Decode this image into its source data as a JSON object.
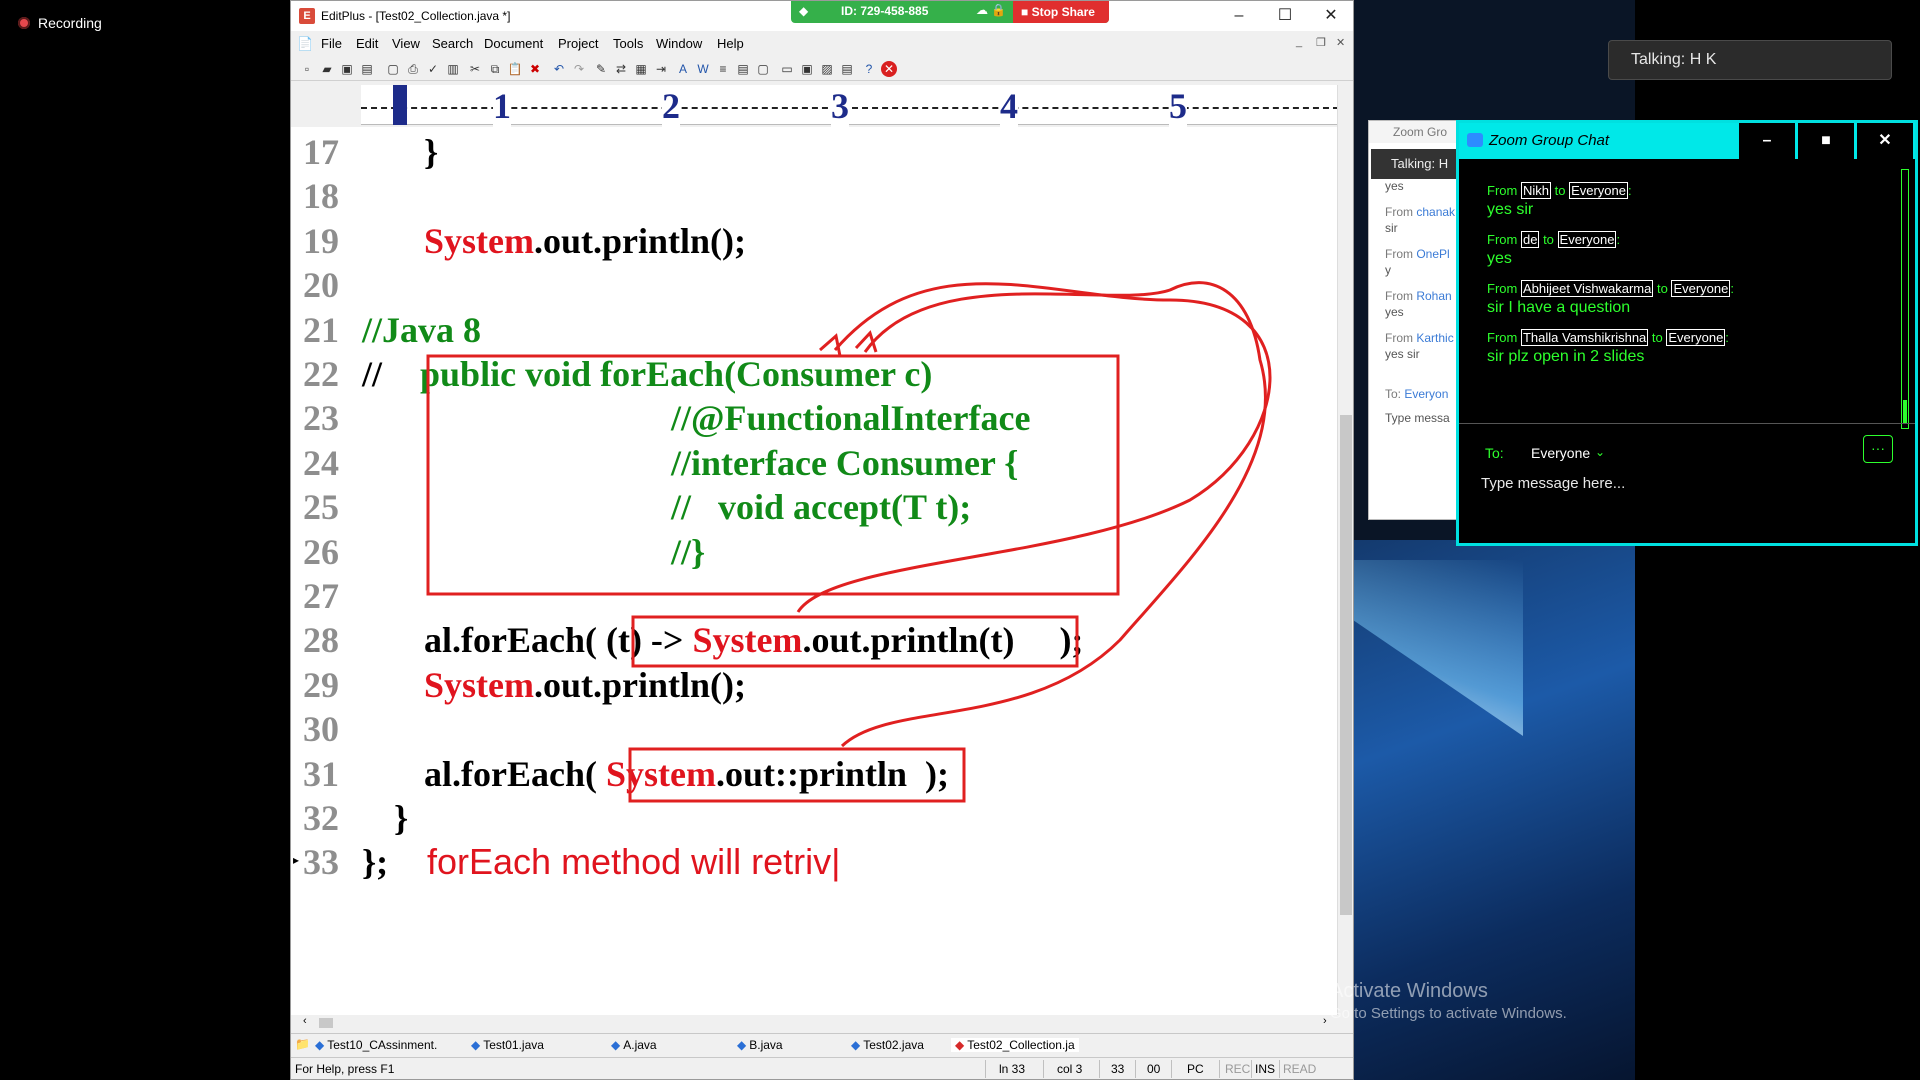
{
  "recording": {
    "label": "Recording"
  },
  "talking_pill": "Talking: H K",
  "share_bar": {
    "meeting_id": "ID: 729-458-885",
    "stop_label": "Stop Share"
  },
  "editplus": {
    "title": "EditPlus - [Test02_Collection.java *]",
    "menu": [
      "File",
      "Edit",
      "View",
      "Search",
      "Document",
      "Project",
      "Tools",
      "Window",
      "Help"
    ],
    "ruler_numbers": [
      "1",
      "2",
      "3",
      "4",
      "5"
    ],
    "lines": [
      {
        "no": "17",
        "code": "}"
      },
      {
        "no": "18",
        "code": ""
      },
      {
        "no": "19",
        "sys": "System",
        "rest": ".out.println();"
      },
      {
        "no": "20",
        "code": ""
      },
      {
        "no": "21",
        "comment": "//Java 8"
      },
      {
        "no": "22",
        "prefix": "//",
        "comment": "public void forEach(Consumer c)"
      },
      {
        "no": "23",
        "comment": "//@FunctionalInterface"
      },
      {
        "no": "24",
        "comment": "//interface Consumer {"
      },
      {
        "no": "25",
        "comment": "//   void accept(T t);"
      },
      {
        "no": "26",
        "comment": "//}"
      },
      {
        "no": "27",
        "code": ""
      },
      {
        "no": "28",
        "a": "al.forEach( (t) -> ",
        "sys": "System",
        "b": ".out.println(t)     );"
      },
      {
        "no": "29",
        "sys": "System",
        "rest": ".out.println();"
      },
      {
        "no": "30",
        "code": ""
      },
      {
        "no": "31",
        "a": "al.forEach( ",
        "sys": "System",
        "b": ".out::println  );"
      },
      {
        "no": "32",
        "code": "}"
      },
      {
        "no": "33",
        "code": "};"
      }
    ],
    "typed_annotation": "forEach method will retriv|",
    "file_tabs": [
      "Test10_CAssinment.",
      "Test01.java",
      "A.java",
      "B.java",
      "Test02.java",
      "Test02_Collection.ja"
    ],
    "status": {
      "help": "For Help, press F1",
      "line": "ln 33",
      "col": "col 3",
      "num": "33",
      "hex": "00",
      "pc": "PC",
      "rec": "REC",
      "ins": "INS",
      "read": "READ"
    }
  },
  "bg_chat": {
    "title": "Zoom Gro",
    "talking": "Talking: H",
    "items": [
      {
        "type": "body",
        "text": "yes"
      },
      {
        "type": "from",
        "text": "From ",
        "name": "chanak"
      },
      {
        "type": "body",
        "text": "sir"
      },
      {
        "type": "from",
        "text": "From ",
        "name": "OnePl"
      },
      {
        "type": "body",
        "text": "y"
      },
      {
        "type": "from",
        "text": "From ",
        "name": "Rohan"
      },
      {
        "type": "body",
        "text": "yes"
      },
      {
        "type": "from",
        "text": "From ",
        "name": "Karthic"
      },
      {
        "type": "body",
        "text": "yes sir"
      },
      {
        "type": "from",
        "text": "To:  ",
        "name": "Everyon"
      },
      {
        "type": "body",
        "text": "Type messa"
      }
    ]
  },
  "zoom_chat": {
    "title": "Zoom Group Chat",
    "messages": [
      {
        "from_word": "From",
        "sender": "Nikh",
        "to_word": "to",
        "recipient": "Everyone",
        "text": "yes sir"
      },
      {
        "from_word": "From",
        "sender": "de",
        "to_word": "to",
        "recipient": "Everyone",
        "text": "yes"
      },
      {
        "from_word": "From",
        "sender": "Abhijeet Vishwakarma",
        "to_word": "to",
        "recipient": "Everyone",
        "text": "sir I have  a question"
      },
      {
        "from_word": "From",
        "sender": "Thalla Vamshikrishna",
        "to_word": "to",
        "recipient": "Everyone",
        "text": "sir plz open in 2 slides"
      }
    ],
    "to_label": "To:",
    "to_value": "Everyone",
    "input_placeholder": "Type message here...",
    "more_label": "···"
  },
  "activate_windows": {
    "title": "Activate Windows",
    "subtitle": "Go to Settings to activate Windows."
  },
  "colors": {
    "accent_cyan": "#00e8e8",
    "chat_green": "#2dff2d",
    "code_red": "#e0141e",
    "comment_green": "#118a18",
    "annotation_red": "#e02020"
  }
}
